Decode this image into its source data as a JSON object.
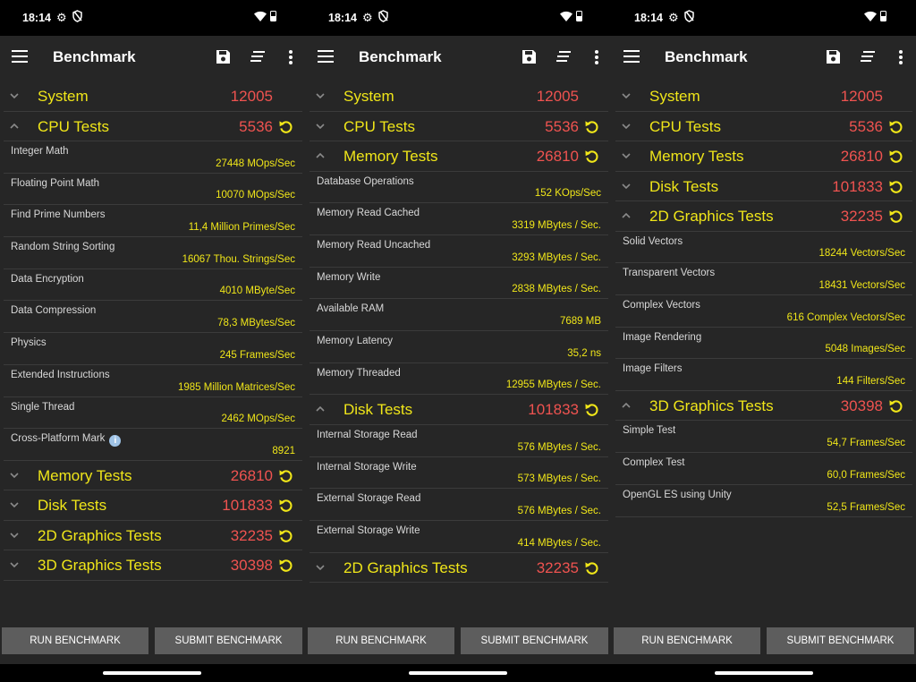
{
  "status": {
    "time": "18:14"
  },
  "app": {
    "title": "Benchmark",
    "run_label": "RUN BENCHMARK",
    "submit_label": "SUBMIT BENCHMARK"
  },
  "colors": {
    "section_text": "#f0e619",
    "score_text": "#ef5350",
    "item_value": "#f0e619",
    "background": "#262626",
    "button": "#5d5d5d"
  },
  "screens": [
    {
      "rows": [
        {
          "type": "section",
          "name": "System",
          "score": "12005",
          "expanded": false,
          "reload": false
        },
        {
          "type": "section",
          "name": "CPU Tests",
          "score": "5536",
          "expanded": true,
          "reload": true
        },
        {
          "type": "item",
          "name": "Integer Math",
          "value": "27448 MOps/Sec"
        },
        {
          "type": "item",
          "name": "Floating Point Math",
          "value": "10070 MOps/Sec"
        },
        {
          "type": "item",
          "name": "Find Prime Numbers",
          "value": "11,4 Million Primes/Sec"
        },
        {
          "type": "item",
          "name": "Random String Sorting",
          "value": "16067 Thou. Strings/Sec"
        },
        {
          "type": "item",
          "name": "Data Encryption",
          "value": "4010 MByte/Sec"
        },
        {
          "type": "item",
          "name": "Data Compression",
          "value": "78,3 MBytes/Sec"
        },
        {
          "type": "item",
          "name": "Physics",
          "value": "245 Frames/Sec"
        },
        {
          "type": "item",
          "name": "Extended Instructions",
          "value": "1985 Million Matrices/Sec"
        },
        {
          "type": "item",
          "name": "Single Thread",
          "value": "2462 MOps/Sec"
        },
        {
          "type": "item",
          "name": "Cross-Platform Mark",
          "value": "8921",
          "info": true
        },
        {
          "type": "section",
          "name": "Memory Tests",
          "score": "26810",
          "expanded": false,
          "reload": true
        },
        {
          "type": "section",
          "name": "Disk Tests",
          "score": "101833",
          "expanded": false,
          "reload": true
        },
        {
          "type": "section",
          "name": "2D Graphics Tests",
          "score": "32235",
          "expanded": false,
          "reload": true
        },
        {
          "type": "section",
          "name": "3D Graphics Tests",
          "score": "30398",
          "expanded": false,
          "reload": true
        }
      ]
    },
    {
      "rows": [
        {
          "type": "section",
          "name": "System",
          "score": "12005",
          "expanded": false,
          "reload": false
        },
        {
          "type": "section",
          "name": "CPU Tests",
          "score": "5536",
          "expanded": false,
          "reload": true
        },
        {
          "type": "section",
          "name": "Memory Tests",
          "score": "26810",
          "expanded": true,
          "reload": true
        },
        {
          "type": "item",
          "name": "Database Operations",
          "value": "152 KOps/Sec"
        },
        {
          "type": "item",
          "name": "Memory Read Cached",
          "value": "3319 MBytes / Sec."
        },
        {
          "type": "item",
          "name": "Memory Read Uncached",
          "value": "3293 MBytes / Sec."
        },
        {
          "type": "item",
          "name": "Memory Write",
          "value": "2838 MBytes / Sec."
        },
        {
          "type": "item",
          "name": "Available RAM",
          "value": "7689 MB"
        },
        {
          "type": "item",
          "name": "Memory Latency",
          "value": "35,2 ns"
        },
        {
          "type": "item",
          "name": "Memory Threaded",
          "value": "12955 MBytes / Sec."
        },
        {
          "type": "section",
          "name": "Disk Tests",
          "score": "101833",
          "expanded": true,
          "reload": true
        },
        {
          "type": "item",
          "name": "Internal Storage Read",
          "value": "576 MBytes / Sec."
        },
        {
          "type": "item",
          "name": "Internal Storage Write",
          "value": "573 MBytes / Sec."
        },
        {
          "type": "item",
          "name": "External Storage Read",
          "value": "576 MBytes / Sec."
        },
        {
          "type": "item",
          "name": "External Storage Write",
          "value": "414 MBytes / Sec."
        },
        {
          "type": "section",
          "name": "2D Graphics Tests",
          "score": "32235",
          "expanded": false,
          "reload": true
        }
      ]
    },
    {
      "rows": [
        {
          "type": "section",
          "name": "System",
          "score": "12005",
          "expanded": false,
          "reload": false
        },
        {
          "type": "section",
          "name": "CPU Tests",
          "score": "5536",
          "expanded": false,
          "reload": true
        },
        {
          "type": "section",
          "name": "Memory Tests",
          "score": "26810",
          "expanded": false,
          "reload": true
        },
        {
          "type": "section",
          "name": "Disk Tests",
          "score": "101833",
          "expanded": false,
          "reload": true
        },
        {
          "type": "section",
          "name": "2D Graphics Tests",
          "score": "32235",
          "expanded": true,
          "reload": true
        },
        {
          "type": "item",
          "name": "Solid Vectors",
          "value": "18244 Vectors/Sec"
        },
        {
          "type": "item",
          "name": "Transparent Vectors",
          "value": "18431 Vectors/Sec"
        },
        {
          "type": "item",
          "name": "Complex Vectors",
          "value": "616 Complex Vectors/Sec"
        },
        {
          "type": "item",
          "name": "Image Rendering",
          "value": "5048 Images/Sec"
        },
        {
          "type": "item",
          "name": "Image Filters",
          "value": "144 Filters/Sec"
        },
        {
          "type": "section",
          "name": "3D Graphics Tests",
          "score": "30398",
          "expanded": true,
          "reload": true
        },
        {
          "type": "item",
          "name": "Simple Test",
          "value": "54,7 Frames/Sec"
        },
        {
          "type": "item",
          "name": "Complex Test",
          "value": "60,0 Frames/Sec"
        },
        {
          "type": "item",
          "name": "OpenGL ES using Unity",
          "value": "52,5 Frames/Sec"
        }
      ]
    }
  ]
}
